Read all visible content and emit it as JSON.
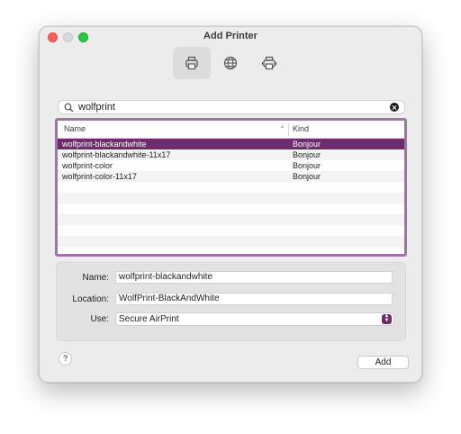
{
  "window": {
    "title": "Add Printer"
  },
  "toolbar": {
    "items": [
      {
        "icon": "printer-icon",
        "active": true
      },
      {
        "icon": "globe-icon",
        "active": false
      },
      {
        "icon": "printer-windows-icon",
        "active": false
      }
    ]
  },
  "search": {
    "value": "wolfprint"
  },
  "table": {
    "headers": {
      "name": "Name",
      "kind": "Kind"
    },
    "rows": [
      {
        "name": "wolfprint-blackandwhite",
        "kind": "Bonjour",
        "selected": true
      },
      {
        "name": "wolfprint-blackandwhite-11x17",
        "kind": "Bonjour",
        "selected": false
      },
      {
        "name": "wolfprint-color",
        "kind": "Bonjour",
        "selected": false
      },
      {
        "name": "wolfprint-color-11x17",
        "kind": "Bonjour",
        "selected": false
      }
    ]
  },
  "form": {
    "name_label": "Name:",
    "name_value": "wolfprint-blackandwhite",
    "location_label": "Location:",
    "location_value": "WolfPrint-BlackAndWhite",
    "use_label": "Use:",
    "use_value": "Secure AirPrint"
  },
  "footer": {
    "help_label": "?",
    "add_label": "Add"
  },
  "colors": {
    "accent": "#6e2b6d",
    "focus_ring": "#9d73a8"
  }
}
